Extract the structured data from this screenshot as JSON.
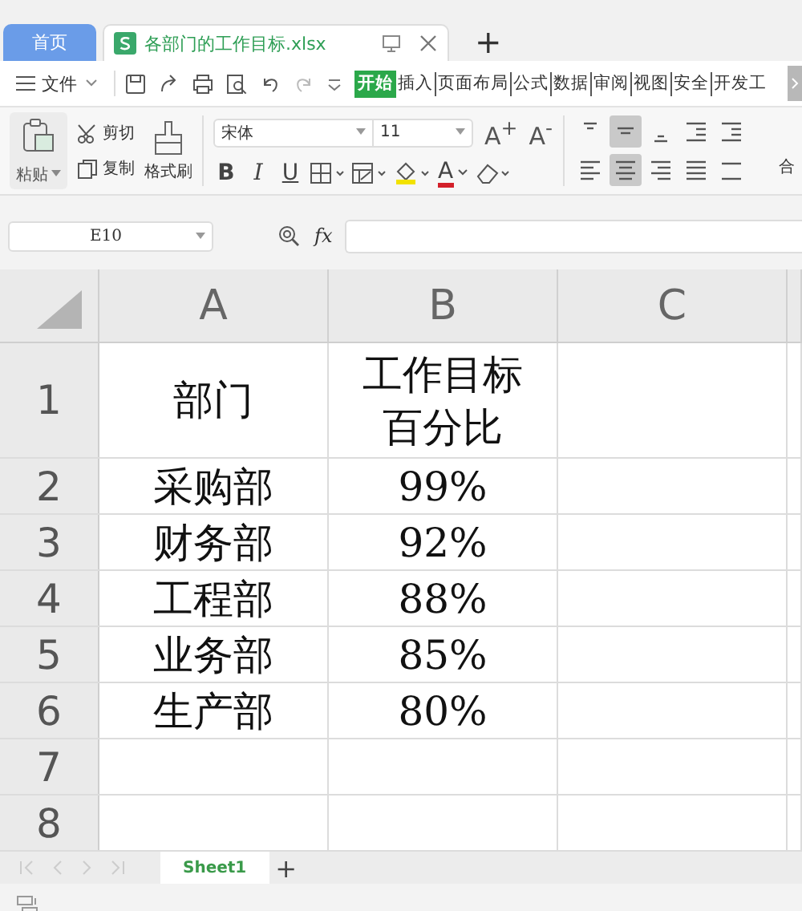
{
  "window_tabs": [
    {
      "label": "首页",
      "kind": "home",
      "selected": false
    },
    {
      "label": "各部门的工作目标.xlsx",
      "kind": "file",
      "selected": true
    }
  ],
  "new_tab": "+",
  "menu": {
    "file": "文件",
    "ribbon_tabs": [
      {
        "label": "开始",
        "selected": true
      },
      {
        "label": "插入",
        "selected": false
      },
      {
        "label": "页面布局",
        "selected": false
      },
      {
        "label": "公式",
        "selected": false
      },
      {
        "label": "数据",
        "selected": false
      },
      {
        "label": "审阅",
        "selected": false
      },
      {
        "label": "视图",
        "selected": false
      },
      {
        "label": "安全",
        "selected": false
      },
      {
        "label": "开发工",
        "selected": false
      }
    ]
  },
  "toolbar": {
    "paste": "粘贴",
    "cut": "剪切",
    "copy": "复制",
    "format_painter": "格式刷",
    "font_name": "宋体",
    "font_size": "11",
    "grow_font": "A$^{+}$",
    "shrink_font": "A$^{-}$",
    "styles": [
      {
        "label": "B",
        "kind": "bold"
      },
      {
        "label": "I",
        "kind": "italic"
      },
      {
        "label": "U",
        "kind": "underline"
      }
    ],
    "font_color": "A",
    "align_buttons": [
      {
        "kind": "top",
        "selected": false
      },
      {
        "kind": "middle",
        "selected": true
      },
      {
        "kind": "bottom",
        "selected": false
      },
      {
        "kind": "outdent",
        "selected": false
      },
      {
        "kind": "indent",
        "selected": false
      },
      {
        "kind": "left",
        "selected": false
      },
      {
        "kind": "center",
        "selected": true
      },
      {
        "kind": "right",
        "selected": false
      },
      {
        "kind": "justify",
        "selected": false
      },
      {
        "kind": "distribute",
        "selected": false
      }
    ],
    "merge": "合"
  },
  "formula_bar": {
    "name_box": "E10",
    "fx": "fx"
  },
  "sheet": {
    "columns": [
      "A",
      "B",
      "C"
    ],
    "rows": [
      {
        "number": "1",
        "cells": [
          "部门",
          "工作目标百分比",
          ""
        ]
      },
      {
        "number": "2",
        "cells": [
          "采购部",
          "99%",
          ""
        ]
      },
      {
        "number": "3",
        "cells": [
          "财务部",
          "92%",
          ""
        ]
      },
      {
        "number": "4",
        "cells": [
          "工程部",
          "88%",
          ""
        ]
      },
      {
        "number": "5",
        "cells": [
          "业务部",
          "85%",
          ""
        ]
      },
      {
        "number": "6",
        "cells": [
          "生产部",
          "80%",
          ""
        ]
      },
      {
        "number": "7",
        "cells": [
          "",
          "",
          ""
        ]
      },
      {
        "number": "8",
        "cells": [
          "",
          "",
          ""
        ]
      }
    ]
  },
  "sheet_tabs": [
    {
      "label": "Sheet1",
      "selected": true
    }
  ],
  "add_sheet": "+"
}
